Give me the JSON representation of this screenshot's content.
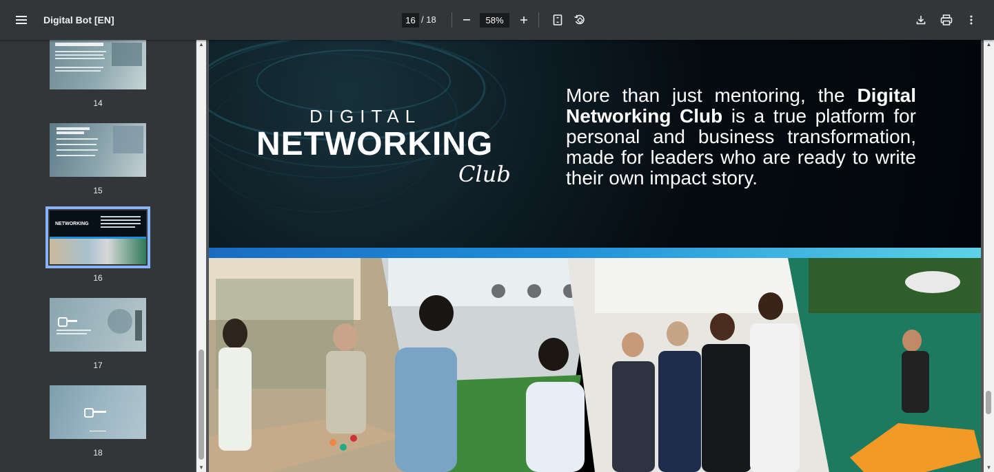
{
  "toolbar": {
    "menu_icon": "menu-icon",
    "title": "Digital Bot [EN]",
    "current_page": "16",
    "total_pages": "/ 18",
    "zoom": "58%",
    "zoom_out_icon": "minus-icon",
    "zoom_in_icon": "plus-icon",
    "fit_icon": "fit-page-icon",
    "rotate_icon": "rotate-icon",
    "download_icon": "download-icon",
    "print_icon": "print-icon",
    "more_icon": "more-vert-icon"
  },
  "sidebar": {
    "thumbnails": [
      {
        "label": "14"
      },
      {
        "label": "15"
      },
      {
        "label": "16",
        "active": true
      },
      {
        "label": "17"
      },
      {
        "label": "18"
      }
    ]
  },
  "page": {
    "logo": {
      "line1": "DIGITAL",
      "line2": "NETWORKING",
      "line3": "Club"
    },
    "text_pre": "More than just mentoring, the ",
    "text_bold": "Digital Networking Club",
    "text_post": " is a true platform for personal and business transformation, made for leaders who are ready to write their own impact story."
  },
  "colors": {
    "toolbar_bg": "#323639",
    "viewer_bg": "#525659",
    "active_thumb_outline": "#8ab4f8",
    "band_start": "#1a6cc0",
    "band_end": "#5cd3e7"
  }
}
